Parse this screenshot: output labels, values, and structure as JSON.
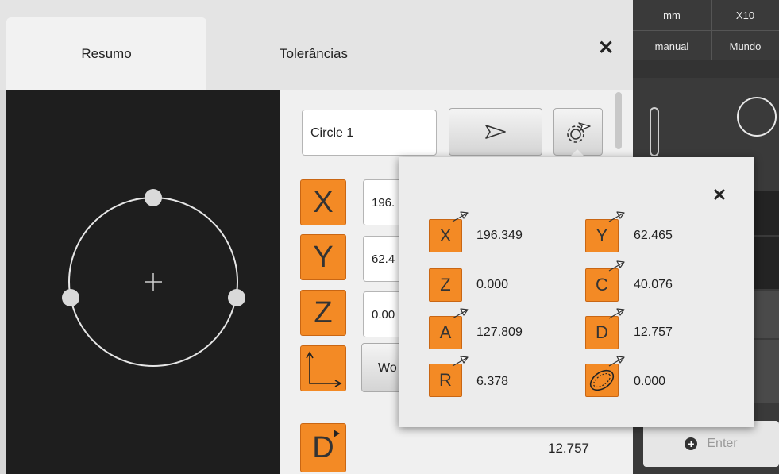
{
  "tabs": {
    "summary": "Resumo",
    "tolerances": "Tolerâncias"
  },
  "feature": {
    "name": "Circle 1"
  },
  "fields": {
    "x": {
      "label": "X",
      "value": "196."
    },
    "y": {
      "label": "Y",
      "value": "62.4"
    },
    "z": {
      "label": "Z",
      "value": "0.00"
    },
    "coord_button": "Wo"
  },
  "diameter": {
    "label": "D",
    "value": "12.757"
  },
  "right_panel": {
    "unit": "mm",
    "zoom": "X10",
    "mode": "manual",
    "coordinate_system": "Mundo",
    "enter_label": "Enter"
  },
  "popup": {
    "items": [
      {
        "label": "X",
        "value": "196.349",
        "icon": "x-arrow-icon"
      },
      {
        "label": "Y",
        "value": "62.465",
        "icon": "y-arrow-icon"
      },
      {
        "label": "Z",
        "value": "0.000",
        "icon": "z-arrow-icon"
      },
      {
        "label": "C",
        "value": "40.076",
        "icon": "c-arrow-icon"
      },
      {
        "label": "A",
        "value": "127.809",
        "icon": "a-arrow-icon"
      },
      {
        "label": "D",
        "value": "12.757",
        "icon": "d-arrow-icon"
      },
      {
        "label": "R",
        "value": "6.378",
        "icon": "r-arrow-icon"
      },
      {
        "label": "",
        "value": "0.000",
        "icon": "form-error-icon"
      }
    ]
  },
  "colors": {
    "accent": "#f38a25",
    "preview_bg": "#1e1e1e",
    "sidebar_bg": "#3a3a3a"
  }
}
